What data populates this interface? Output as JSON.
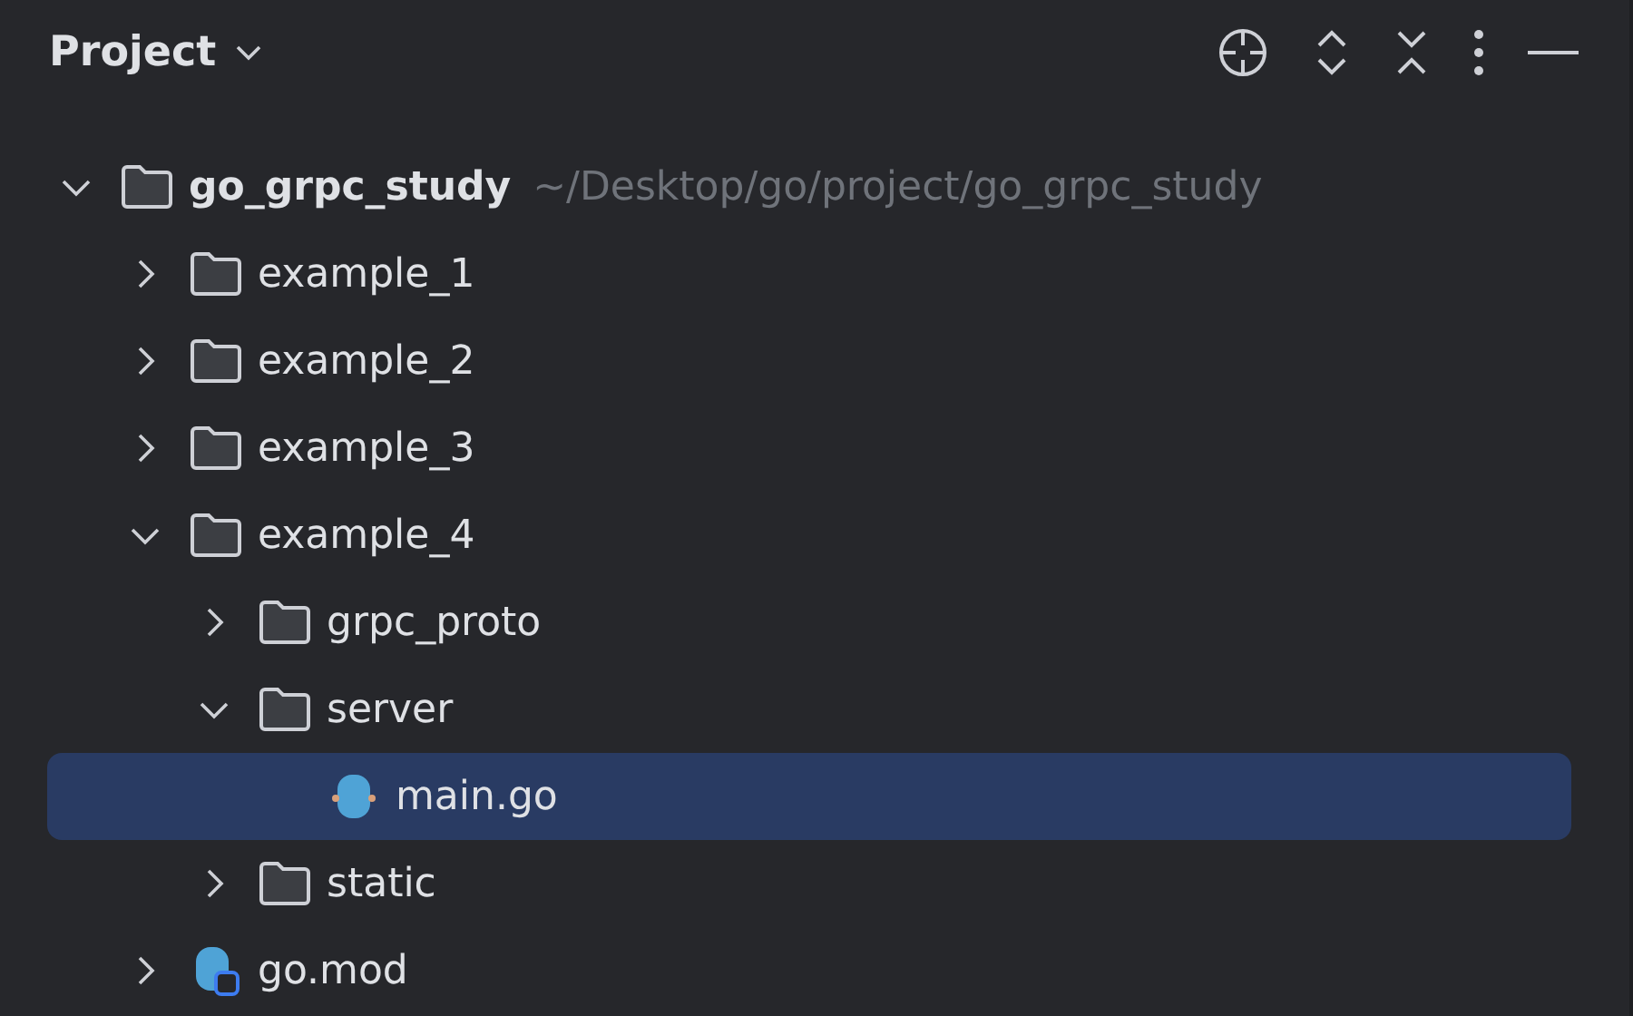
{
  "panel": {
    "title": "Project"
  },
  "tree": [
    {
      "name": "go_grpc_study",
      "kind": "folder",
      "hint": "~/Desktop/go/project/go_grpc_study",
      "expanded": true,
      "selected": false,
      "children": [
        {
          "name": "example_1",
          "kind": "folder",
          "expanded": false,
          "selected": false
        },
        {
          "name": "example_2",
          "kind": "folder",
          "expanded": false,
          "selected": false
        },
        {
          "name": "example_3",
          "kind": "folder",
          "expanded": false,
          "selected": false
        },
        {
          "name": "example_4",
          "kind": "folder",
          "expanded": true,
          "selected": false,
          "children": [
            {
              "name": "grpc_proto",
              "kind": "folder",
              "expanded": false,
              "selected": false
            },
            {
              "name": "server",
              "kind": "folder",
              "expanded": true,
              "selected": false,
              "children": [
                {
                  "name": "main.go",
                  "kind": "gofile",
                  "selected": true
                }
              ]
            },
            {
              "name": "static",
              "kind": "folder",
              "expanded": false,
              "selected": false
            }
          ]
        },
        {
          "name": "go.mod",
          "kind": "modfile",
          "expanded": false,
          "selected": false
        }
      ]
    }
  ]
}
